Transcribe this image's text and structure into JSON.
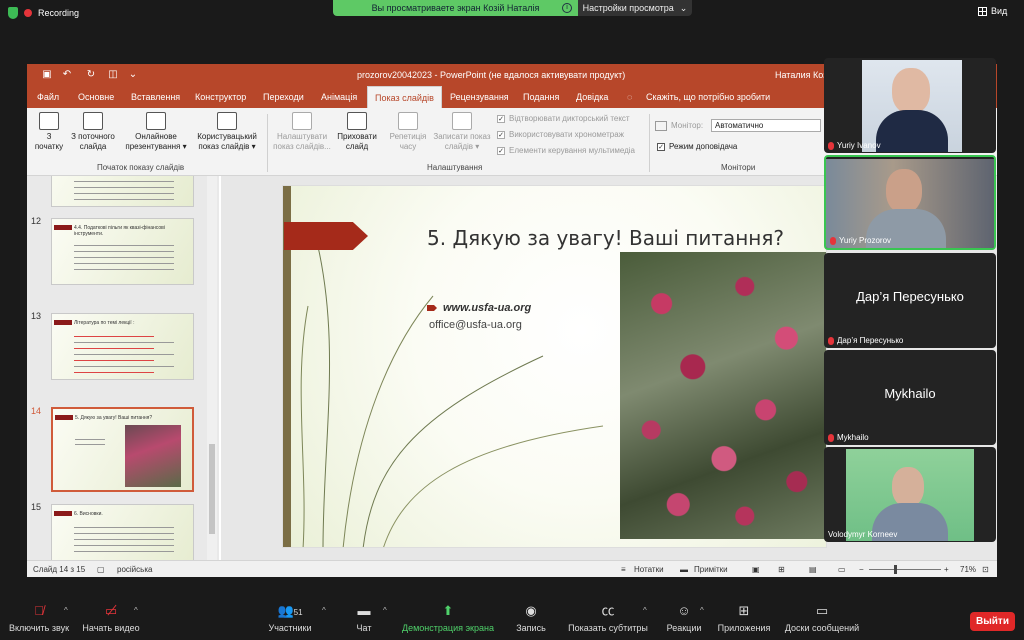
{
  "zoom_top": {
    "recording_label": "Recording",
    "share_banner": "Вы просматриваете экран Козій Наталія",
    "view_settings": "Настройки просмотра",
    "view_button": "Вид"
  },
  "ppt": {
    "title": "prozorov20042023  -  PowerPoint (не вдалося активувати продукт)",
    "user": "Наталия Козі",
    "tabs": [
      "Файл",
      "Основне",
      "Вставлення",
      "Конструктор",
      "Переходи",
      "Анімація",
      "Показ слайдів",
      "Рецензування",
      "Подання",
      "Довідка"
    ],
    "tell_me": "Скажіть, що потрібно зробити",
    "ribbon": {
      "b1": [
        "З",
        "початку"
      ],
      "b2": [
        "З поточного",
        "слайда"
      ],
      "b3": [
        "Онлайнове",
        "презентування ▾"
      ],
      "b4": [
        "Користувацький",
        "показ слайдів ▾"
      ],
      "group1": "Початок показу слайдів",
      "b5": [
        "Налаштувати",
        "показ слайдів..."
      ],
      "b6": [
        "Приховати",
        "слайд"
      ],
      "b7": [
        "Репетиція",
        "часу"
      ],
      "b8": [
        "Записати показ",
        "слайдів ▾"
      ],
      "chk1": "Відтворювати дикторський текст",
      "chk2": "Використовувати хронометраж",
      "chk3": "Елементи керування мультимедіа",
      "group2": "Налаштування",
      "monitor_label": "Монітор:",
      "monitor_value": "Автоматично",
      "presenter_mode": "Режим доповідача",
      "group3": "Монітори"
    },
    "thumbs": {
      "n12": "12",
      "n13": "13",
      "n14": "14",
      "n15": "15",
      "t12": "4.4. Податкові пільги як квазі-фінансові інструменти.",
      "t13": "Література по темі лекції :",
      "t14": "5. Дякую за увагу!  Ваші питання?",
      "t15": "6. Висновки."
    },
    "slide": {
      "title": "5. Дякую за увагу!   Ваші питання?",
      "url": "www.usfa-ua.org",
      "email": "office@usfa-ua.org"
    },
    "status": {
      "slide_of": "Слайд 14 з 15",
      "language": "російська",
      "notes": "Нотатки",
      "comments": "Примітки",
      "zoom": "71%"
    }
  },
  "participants": [
    {
      "name": "Yuriy Ivanov"
    },
    {
      "name": "Yuriy Prozorov"
    },
    {
      "name": "Дар’я Пересунько"
    },
    {
      "name": "Mykhailo"
    },
    {
      "name": "Volodymyr Korneev"
    }
  ],
  "controls": {
    "audio": "Включить звук",
    "video": "Начать видео",
    "participants": "Участники",
    "participants_count": "51",
    "chat": "Чат",
    "share": "Демонстрация экрана",
    "record": "Запись",
    "captions": "Показать субтитры",
    "reactions": "Реакции",
    "apps": "Приложения",
    "whiteboards": "Доски сообщений",
    "leave": "Выйти"
  },
  "colors": {
    "ppt_accent": "#b7472a",
    "share_green": "#5ec965",
    "leave_red": "#e02828"
  }
}
